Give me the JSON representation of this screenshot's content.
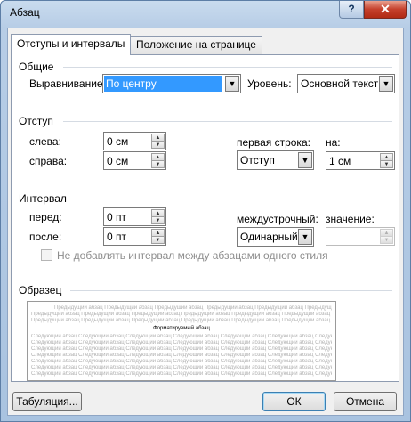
{
  "window": {
    "title": "Абзац",
    "help": "?",
    "close": "✕"
  },
  "tabs": [
    {
      "label": "Отступы и интервалы"
    },
    {
      "label": "Положение на странице"
    }
  ],
  "general": {
    "heading": "Общие",
    "alignment_label": "Выравнивание:",
    "alignment_value": "По центру",
    "level_label": "Уровень:",
    "level_value": "Основной текст"
  },
  "indent": {
    "heading": "Отступ",
    "left_label": "слева:",
    "left_value": "0 см",
    "right_label": "справа:",
    "right_value": "0 см",
    "first_line_label": "первая строка:",
    "first_line_value": "Отступ",
    "by_label": "на:",
    "by_value": "1 см"
  },
  "spacing": {
    "heading": "Интервал",
    "before_label": "перед:",
    "before_value": "0 пт",
    "after_label": "после:",
    "after_value": "0 пт",
    "line_label": "междустрочный:",
    "line_value": "Одинарный",
    "at_label": "значение:",
    "at_value": "",
    "no_space_label": "Не добавлять интервал между абзацами одного стиля"
  },
  "preview": {
    "heading": "Образец",
    "prev_text": "Предыдущий абзац Предыдущий абзац Предыдущий абзац Предыдущий абзац Предыдущий абзац Предыдущий абзац Предыдущий абзац",
    "main_text": "Форматируемый абзац",
    "next_text": "Следующий абзац Следующий абзац Следующий абзац Следующий абзац Следующий абзац Следующий абзац Следующий абзац"
  },
  "buttons": {
    "tabs": "Табуляция...",
    "ok": "ОК",
    "cancel": "Отмена"
  }
}
